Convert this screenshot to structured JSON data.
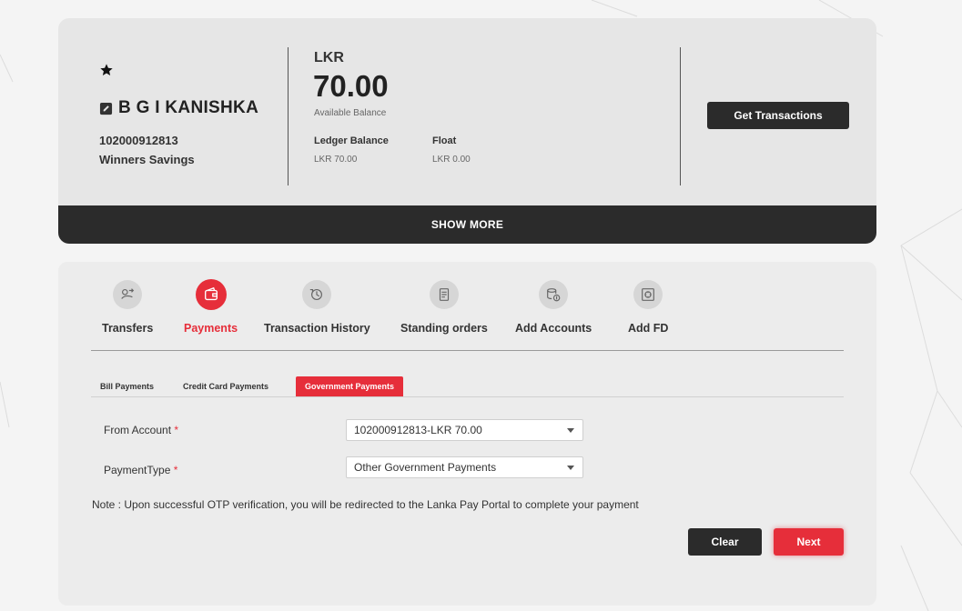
{
  "account": {
    "name": "B G I KANISHKA",
    "number": "102000912813",
    "type": "Winners Savings",
    "currency": "LKR",
    "available_balance": "70.00",
    "available_label": "Available Balance",
    "ledger_label": "Ledger Balance",
    "ledger_value": "LKR 70.00",
    "float_label": "Float",
    "float_value": "LKR 0.00",
    "get_transactions_label": "Get Transactions",
    "show_more_label": "SHOW MORE"
  },
  "menu": [
    {
      "label": "Transfers",
      "icon": "transfer-icon",
      "active": false
    },
    {
      "label": "Payments",
      "icon": "wallet-icon",
      "active": true
    },
    {
      "label": "Transaction History",
      "icon": "transaction-history-icon",
      "active": false
    },
    {
      "label": "Standing orders",
      "icon": "standing-order-icon",
      "active": false
    },
    {
      "label": "Add Accounts",
      "icon": "add-account-icon",
      "active": false
    },
    {
      "label": "Add FD",
      "icon": "safe-icon",
      "active": false
    }
  ],
  "subtabs": [
    {
      "label": "Bill Payments",
      "active": false
    },
    {
      "label": "Credit Card Payments",
      "active": false
    },
    {
      "label": "Government Payments",
      "active": true
    }
  ],
  "form": {
    "from_account_label": "From Account",
    "from_account_value": "102000912813-LKR 70.00",
    "payment_type_label": "PaymentType",
    "payment_type_value": "Other Government Payments",
    "required_marker": "*"
  },
  "note": "Note : Upon successful OTP verification, you will be redirected to the Lanka Pay Portal to complete your payment",
  "buttons": {
    "clear": "Clear",
    "next": "Next"
  },
  "colors": {
    "accent": "#e62e3a",
    "dark": "#2b2b2b",
    "card_bg": "#e6e6e6"
  }
}
